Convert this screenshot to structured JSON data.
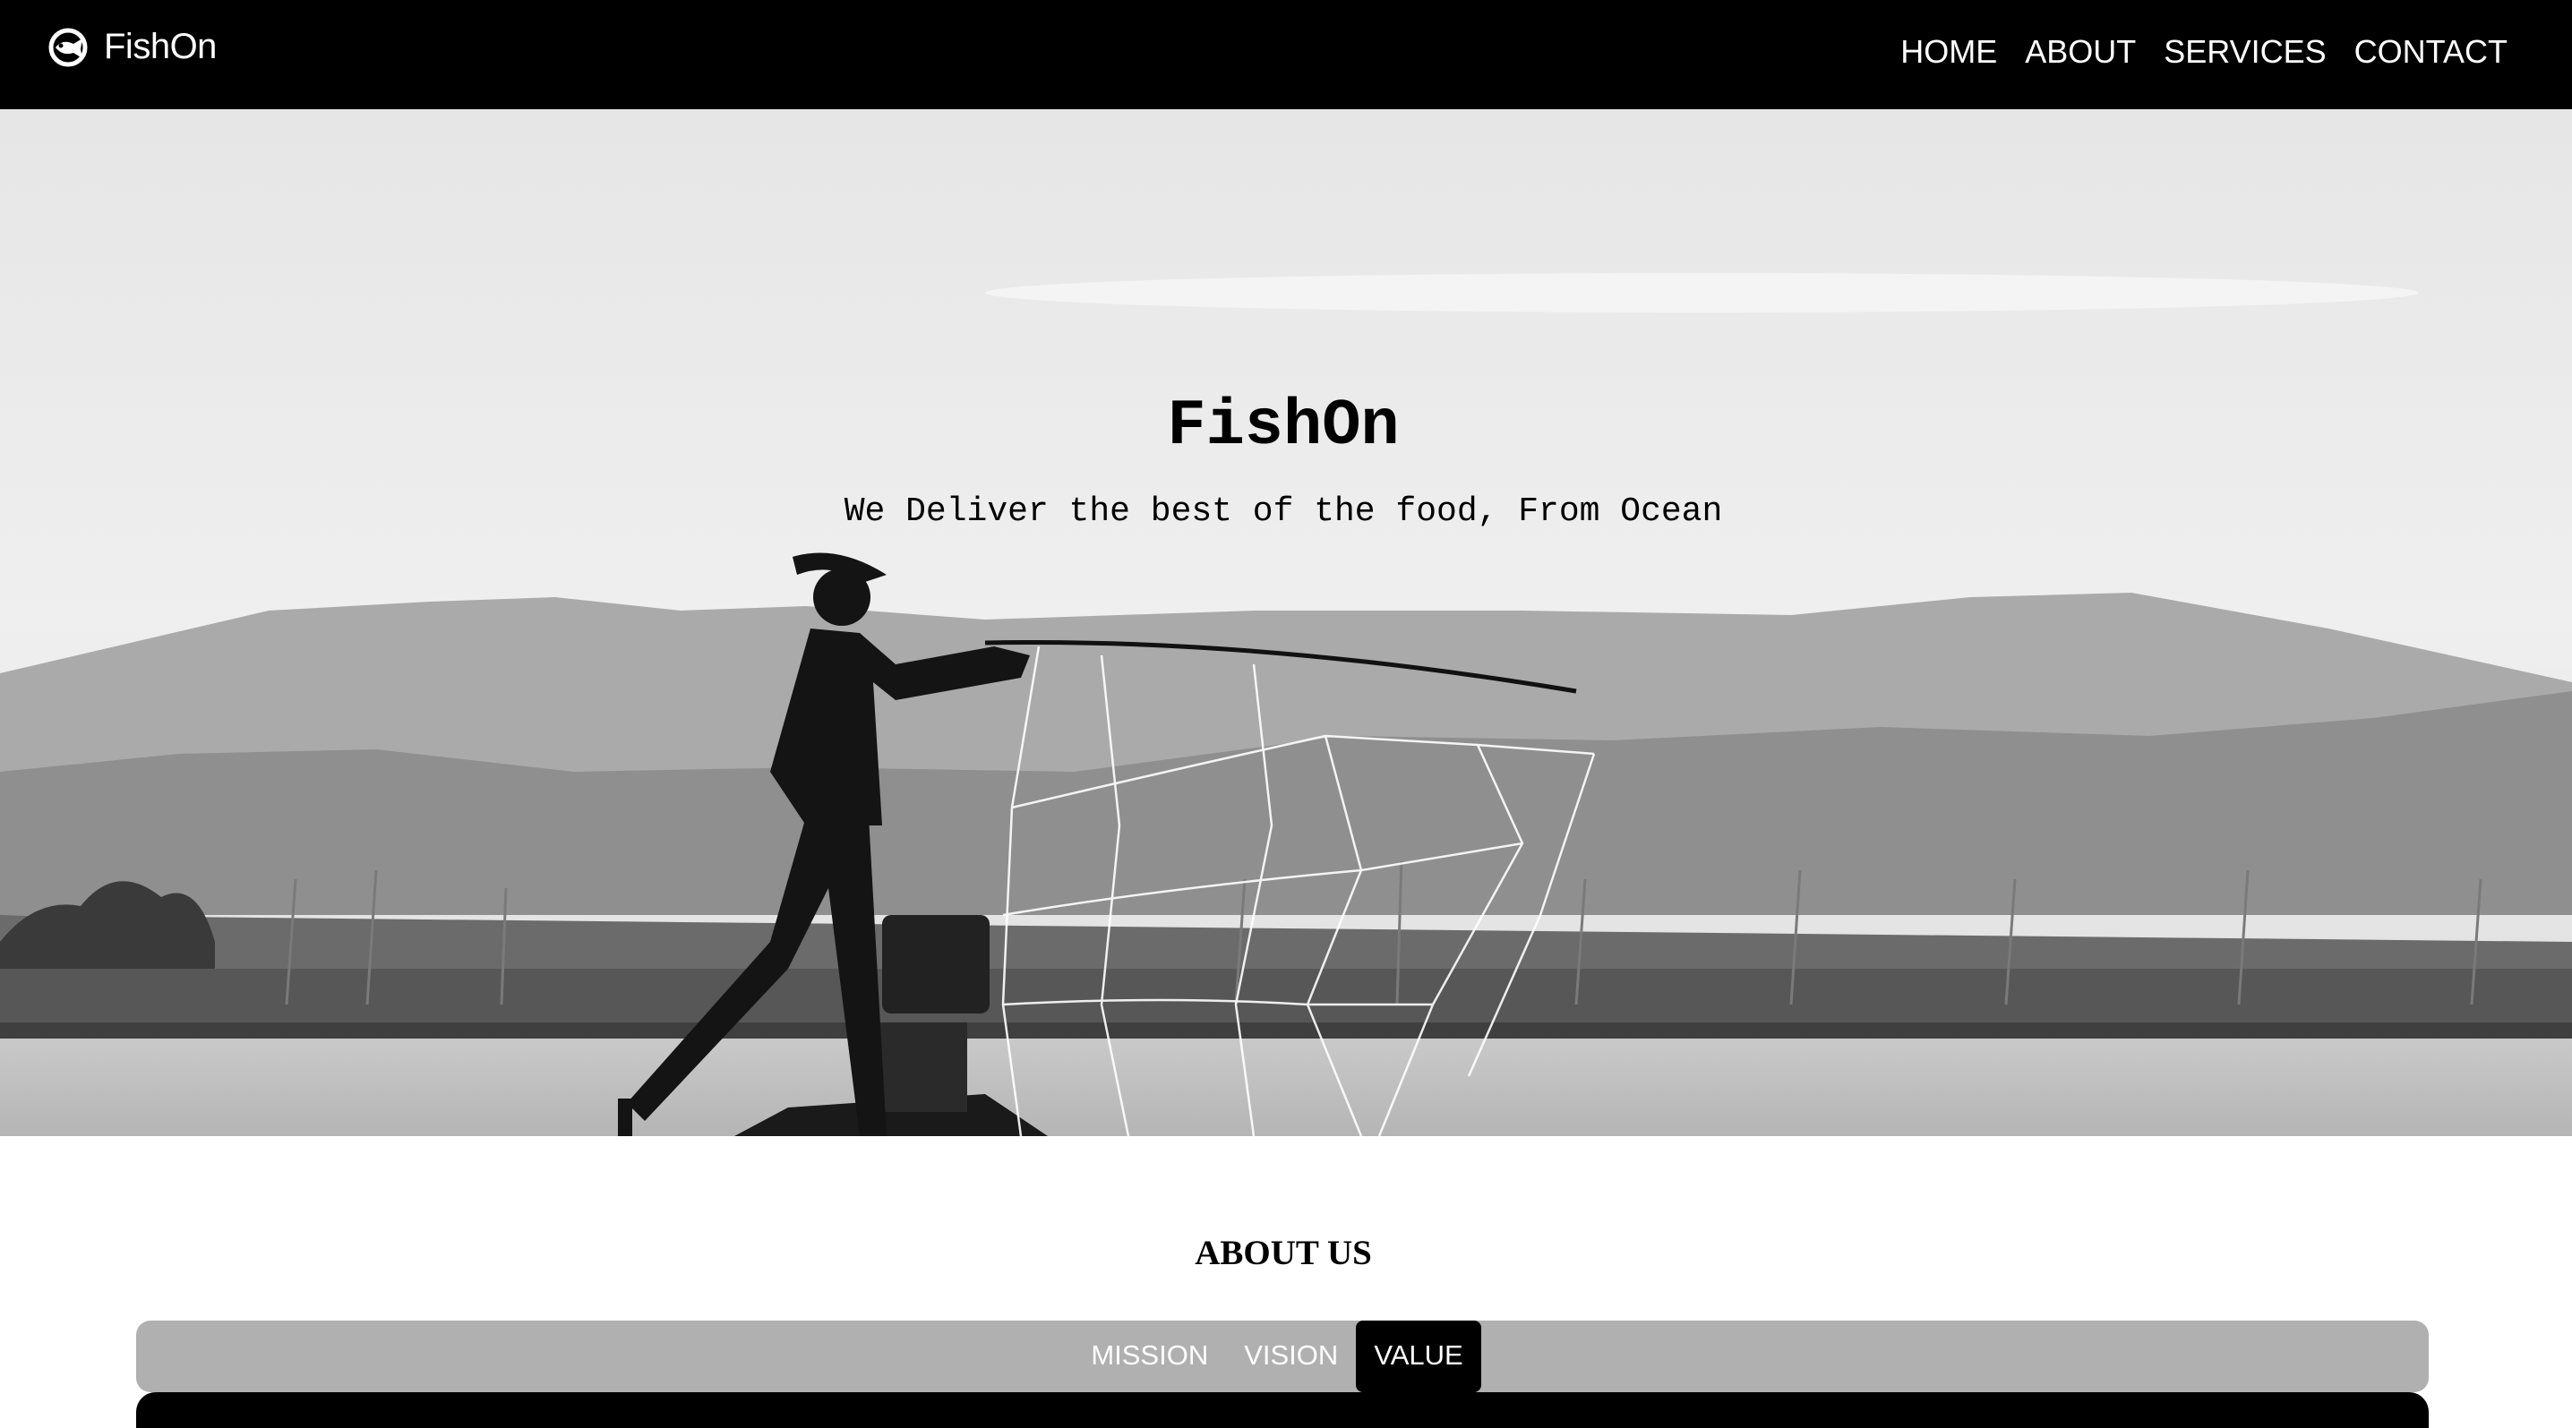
{
  "nav": {
    "brand": "FishOn",
    "brand_icon": "fish-logo-icon",
    "links": [
      {
        "label": "HOME"
      },
      {
        "label": "ABOUT"
      },
      {
        "label": "SERVICES"
      },
      {
        "label": "CONTACT"
      }
    ]
  },
  "hero": {
    "title": "FishOn",
    "subtitle": "We Deliver the best of the food, From Ocean"
  },
  "about": {
    "heading": "ABOUT US",
    "tabs": [
      {
        "label": "MISSION",
        "active": false
      },
      {
        "label": "VISION",
        "active": false
      },
      {
        "label": "VALUE",
        "active": true
      }
    ]
  },
  "colors": {
    "nav_bg": "#000000",
    "nav_text": "#ffffff",
    "tabbar_bg": "#b0b0b0",
    "tab_active_bg": "#000000"
  }
}
